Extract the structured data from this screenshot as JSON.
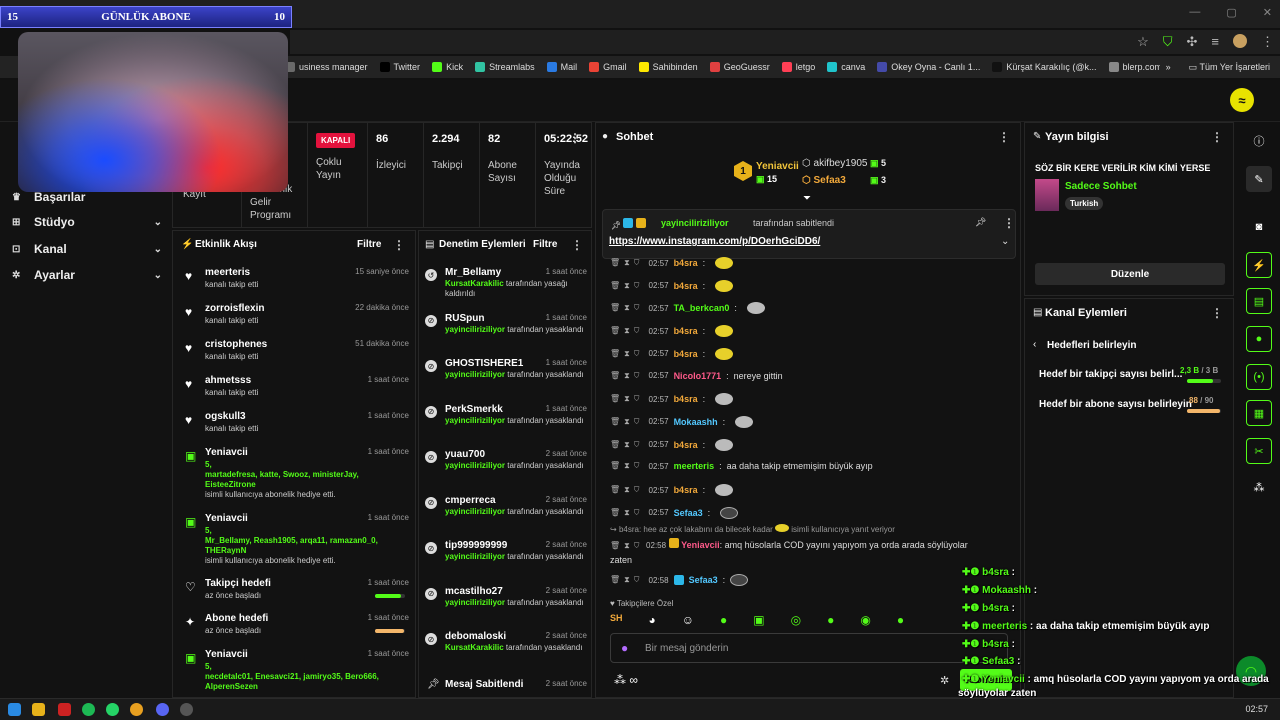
{
  "overlay": {
    "sub_banner": {
      "left": "15",
      "title": "GÜNLÜK ABONE",
      "right": "10"
    }
  },
  "browser": {
    "window_controls": [
      "—",
      "▢",
      "✕"
    ],
    "bookmarks": [
      {
        "label": "usiness manager",
        "color": "#6a6a6a"
      },
      {
        "label": "Twitter",
        "color": "#000000"
      },
      {
        "label": "Kick",
        "color": "#53fc18"
      },
      {
        "label": "Streamlabs",
        "color": "#31c3a2"
      },
      {
        "label": "Mail",
        "color": "#2a7ae2"
      },
      {
        "label": "Gmail",
        "color": "#ea4335"
      },
      {
        "label": "Sahibinden",
        "color": "#ffe800"
      },
      {
        "label": "GeoGuessr",
        "color": "#e04040"
      },
      {
        "label": "letgo",
        "color": "#ff3f55"
      },
      {
        "label": "canva",
        "color": "#20c4cb"
      },
      {
        "label": "Okey Oyna - Canlı 1...",
        "color": "#444aa8"
      },
      {
        "label": "Kürşat Karakılıç (@k...",
        "color": "#111111"
      },
      {
        "label": "blerp.com/dashboar...",
        "color": "#888888"
      }
    ],
    "bookmarks_more": "»",
    "all_bookmarks": "Tüm Yer İşaretleri"
  },
  "sidebar": {
    "items": [
      {
        "label": "Başarılar",
        "icon": "trophy-icon"
      },
      {
        "label": "Stüdyo",
        "icon": "studio-icon"
      },
      {
        "label": "Kanal",
        "icon": "channel-icon"
      },
      {
        "label": "Ayarlar",
        "icon": "settings-icon"
      }
    ]
  },
  "stats": {
    "partial_label": "Kayıt",
    "partner": "Partnerlik Gelir Programı",
    "status_badge": "KAPALI",
    "multi_stream": "Çoklu Yayın",
    "viewers_value": "86",
    "viewers_label": "İzleyici",
    "followers_value": "2.294",
    "followers_label": "Takipçi",
    "subs_value": "82",
    "subs_label": "Abone Sayısı",
    "uptime_value": "05:22:52",
    "uptime_label": "Yayında Olduğu Süre"
  },
  "activity": {
    "title": "Etkinlik Akışı",
    "filter": "Filtre",
    "rows": [
      {
        "name": "meerteris",
        "time": "15 saniye önce",
        "sub": "kanalı takip etti"
      },
      {
        "name": "zorroisflexin",
        "time": "22 dakika önce",
        "sub": "kanalı takip etti"
      },
      {
        "name": "cristophenes",
        "time": "51 dakika önce",
        "sub": "kanalı takip etti"
      },
      {
        "name": "ahmetsss",
        "time": "1 saat önce",
        "sub": "kanalı takip etti"
      },
      {
        "name": "ogskull3",
        "time": "1 saat önce",
        "sub": "kanalı takip etti"
      }
    ],
    "gift1": {
      "name": "Yeniavcii",
      "time": "1 saat önce",
      "count": "5,",
      "users": "martadefresa, katte, Swooz, ministerJay, EisteeZitrone",
      "sub": "isimli kullanıcıya abonelik hediye etti."
    },
    "gift2": {
      "name": "Yeniavcii",
      "time": "1 saat önce",
      "count": "5,",
      "users": "Mr_Bellamy, Reash1905, arqa11, ramazan0_0, THERaynN",
      "sub": "isimli kullanıcıya abonelik hediye etti."
    },
    "goal1": {
      "name": "Takipçi hedefi",
      "time": "1 saat önce",
      "sub": "az önce başladı"
    },
    "goal2": {
      "name": "Abone hedefi",
      "time": "1 saat önce",
      "sub": "az önce başladı"
    },
    "gift3": {
      "name": "Yeniavcii",
      "time": "1 saat önce",
      "count": "5,",
      "users": "necdetalc01, Enesavci21, jamiryo35, Bero666, AlperenSezen"
    }
  },
  "moderation": {
    "title": "Denetim Eylemleri",
    "filter": "Filtre",
    "rows": [
      {
        "name": "Mr_Bellamy",
        "time": "1 saat önce",
        "actor": "KursatKarakilic",
        "sub": " tarafından yasağı kaldırıldı",
        "icon": "undo-icon"
      },
      {
        "name": "RUSpun",
        "time": "1 saat önce",
        "actor": "yayinciliriziliyor",
        "sub": " tarafından yasaklandı",
        "icon": "ban-icon"
      },
      {
        "name": "GHOSTISHERE1",
        "time": "1 saat önce",
        "actor": "yayinciliriziliyor",
        "sub": " tarafından yasaklandı",
        "icon": "ban-icon"
      },
      {
        "name": "PerkSmerkk",
        "time": "1 saat önce",
        "actor": "yayinciliriziliyor",
        "sub": " tarafından yasaklandı",
        "icon": "ban-icon"
      },
      {
        "name": "yuau700",
        "time": "2 saat önce",
        "actor": "yayinciliriziliyor",
        "sub": " tarafından yasaklandı",
        "icon": "ban-icon"
      },
      {
        "name": "cmperreca",
        "time": "2 saat önce",
        "actor": "yayinciliriziliyor",
        "sub": " tarafından yasaklandı",
        "icon": "ban-icon"
      },
      {
        "name": "tip999999999",
        "time": "2 saat önce",
        "actor": "yayinciliriziliyor",
        "sub": " tarafından yasaklandı",
        "icon": "ban-icon"
      },
      {
        "name": "mcastilho27",
        "time": "2 saat önce",
        "actor": "yayinciliriziliyor",
        "sub": " tarafından yasaklandı",
        "icon": "ban-icon"
      },
      {
        "name": "debomaloski",
        "time": "2 saat önce",
        "actor": "KursatKarakilic",
        "sub": " tarafından yasaklandı",
        "icon": "ban-icon"
      }
    ],
    "pinned": {
      "name": "Mesaj Sabitlendi",
      "time": "2 saat önce"
    }
  },
  "chat": {
    "title": "Sohbet",
    "top1_name": "Yeniavcii",
    "top1_count": "15",
    "top1_rank": "1",
    "top2_name": "akifbey1905",
    "top2_count": "5",
    "top3_name": "Sefaa3",
    "top3_count": "3",
    "pinned_user": "yayinciliriziliyor",
    "pinned_note": "tarafından sabitlendi",
    "pinned_link": "https://www.instagram.com/p/DOerhGciDD6/",
    "lines": [
      {
        "time": "02:57",
        "user": "b4sra",
        "color": "#f2a93b",
        "text": "",
        "emote": "yellow"
      },
      {
        "time": "02:57",
        "user": "b4sra",
        "color": "#f2a93b",
        "text": "",
        "emote": "yellow"
      },
      {
        "time": "02:57",
        "user": "TA_berkcan0",
        "color": "#53fc18",
        "text": "",
        "emote": "grey"
      },
      {
        "time": "02:57",
        "user": "b4sra",
        "color": "#f2a93b",
        "text": "",
        "emote": "yellow"
      },
      {
        "time": "02:57",
        "user": "b4sra",
        "color": "#f2a93b",
        "text": "",
        "emote": "yellow"
      },
      {
        "time": "02:57",
        "user": "Nicolo1771",
        "color": "#ff5a8a",
        "text": "nereye gittin",
        "emote": ""
      },
      {
        "time": "02:57",
        "user": "b4sra",
        "color": "#f2a93b",
        "text": "",
        "emote": "grey"
      },
      {
        "time": "02:57",
        "user": "Mokaashh",
        "color": "#53c8ff",
        "text": "",
        "emote": "grey"
      },
      {
        "time": "02:57",
        "user": "b4sra",
        "color": "#f2a93b",
        "text": "",
        "emote": "grey"
      },
      {
        "time": "02:57",
        "user": "meerteris",
        "color": "#53fc18",
        "text": "aa daha takip etmemişim büyük ayıp",
        "emote": ""
      },
      {
        "time": "02:57",
        "user": "b4sra",
        "color": "#f2a93b",
        "text": "",
        "emote": "grey"
      },
      {
        "time": "02:57",
        "user": "Sefaa3",
        "color": "#53c8ff",
        "text": "",
        "emote": "dark"
      }
    ],
    "reply_note": "b4sra: hee az çok lakabını da bilecek kadar",
    "reply_note_end": "isimli kullanıcıya yanıt veriyor",
    "long_msg_time": "02:58",
    "long_msg_user": "Yeniavcii",
    "long_msg_text": "amq hüsolarla COD yayını yapıyom ya orda arada söylüyolar zaten",
    "last_time": "02:58",
    "last_user": "Sefaa3",
    "followers_only_label": "Takipçilere Özel",
    "input_placeholder": "Bir mesaj gönderin",
    "send_label": "Sohbet"
  },
  "stream_info": {
    "title": "Yayın bilgisi",
    "stream_title": "SÖZ BİR KERE VERİLİR KİM KİMİ YERSE",
    "category": "Sadece Sohbet",
    "language": "Turkish",
    "edit_label": "Düzenle"
  },
  "channel_actions": {
    "title": "Kanal Eylemleri",
    "back_label": "Hedefleri belirleyin",
    "goal1_label": "Hedef bir takipçi sayısı belirl...",
    "goal1_current": "2,3 B",
    "goal1_target": " / 3 B",
    "goal1_progress": 0.77,
    "goal2_label": "Hedef bir abone sayısı belirleyin",
    "goal2_current": "88",
    "goal2_target": " / 90",
    "goal2_progress": 0.98
  },
  "overlay_chat": [
    {
      "user": "b4sra",
      "text": "",
      "color": "#53fc18"
    },
    {
      "user": "Mokaashh",
      "text": "",
      "color": "#53fc18"
    },
    {
      "user": "b4sra",
      "text": "",
      "color": "#53fc18"
    },
    {
      "user": "meerteris",
      "text": "aa daha takip etmemişim büyük ayıp",
      "color": "#53fc18"
    },
    {
      "user": "b4sra",
      "text": "",
      "color": "#53fc18"
    },
    {
      "user": "Sefaa3",
      "text": "",
      "color": "#53fc18"
    },
    {
      "user": "Yeniavcii",
      "text": "amq hüsolarla COD yayını yapıyom ya orda arada",
      "color": "#53fc18"
    },
    {
      "user": "",
      "text": "söylüyolar zaten",
      "color": "#ffffff"
    },
    {
      "user": "Sefaa3",
      "text": "",
      "color": "#53fc18"
    }
  ],
  "taskbar": {
    "time": "02:57"
  },
  "colors": {
    "accent": "#53fc18",
    "bg": "#121212",
    "kapali": "#e3123d"
  }
}
